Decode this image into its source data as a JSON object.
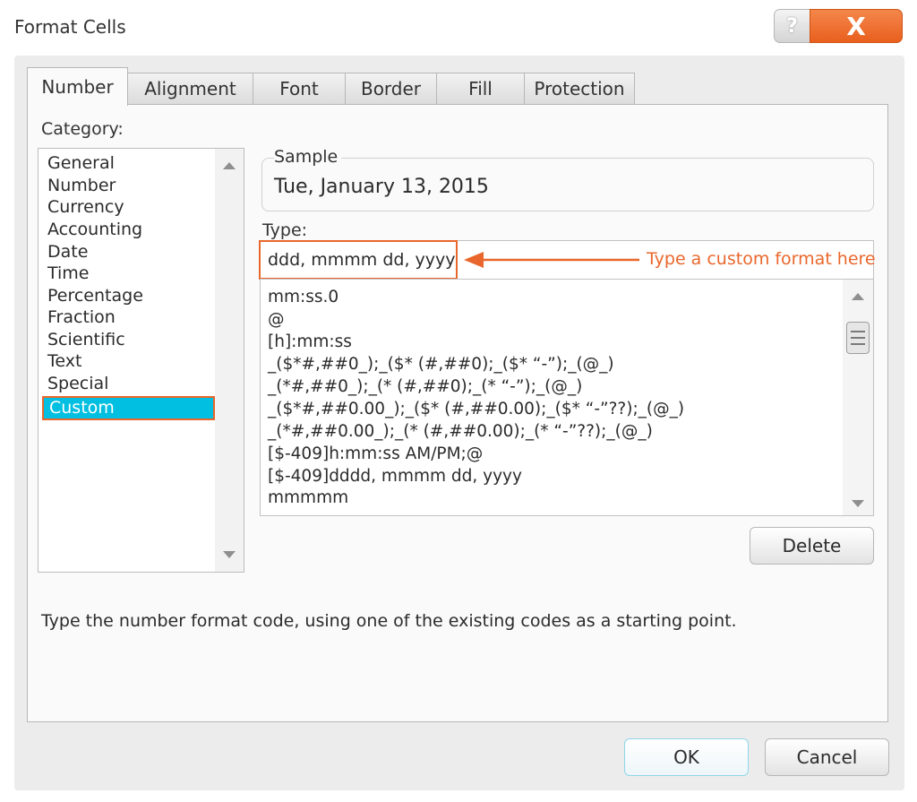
{
  "window": {
    "title": "Format Cells",
    "help_label": "?",
    "close_label": "X"
  },
  "tabs": [
    {
      "label": "Number",
      "active": true
    },
    {
      "label": "Alignment",
      "active": false
    },
    {
      "label": "Font",
      "active": false
    },
    {
      "label": "Border",
      "active": false
    },
    {
      "label": "Fill",
      "active": false
    },
    {
      "label": "Protection",
      "active": false
    }
  ],
  "category": {
    "label": "Category:",
    "items": [
      "General",
      "Number",
      "Currency",
      "Accounting",
      "Date",
      "Time",
      "Percentage",
      "Fraction",
      "Scientific",
      "Text",
      "Special",
      "Custom"
    ],
    "selected": "Custom"
  },
  "sample": {
    "label": "Sample",
    "value": "Tue, January 13, 2015"
  },
  "type": {
    "label": "Type:",
    "value": "ddd, mmmm dd, yyyy",
    "callout": "Type a custom format here",
    "formats": [
      "mm:ss.0",
      "@",
      "[h]:mm:ss",
      "_($*#,##0_);_($* (#,##0);_($* “-”);_(@_)",
      "_(*#,##0_);_(* (#,##0);_(* “-”);_(@_)",
      "_($*#,##0.00_);_($* (#,##0.00);_($* “-”??);_(@_)",
      "_(*#,##0.00_);_(* (#,##0.00);_(* “-”??);_(@_)",
      "[$-409]h:mm:ss AM/PM;@",
      "[$-409]dddd, mmmm dd, yyyy",
      "mmmmm"
    ]
  },
  "buttons": {
    "delete": "Delete",
    "ok": "OK",
    "cancel": "Cancel"
  },
  "hint": "Type the number format code, using one of the existing codes as a starting point.",
  "colors": {
    "accent_orange": "#e9672c",
    "selection_cyan": "#00bfe0"
  }
}
